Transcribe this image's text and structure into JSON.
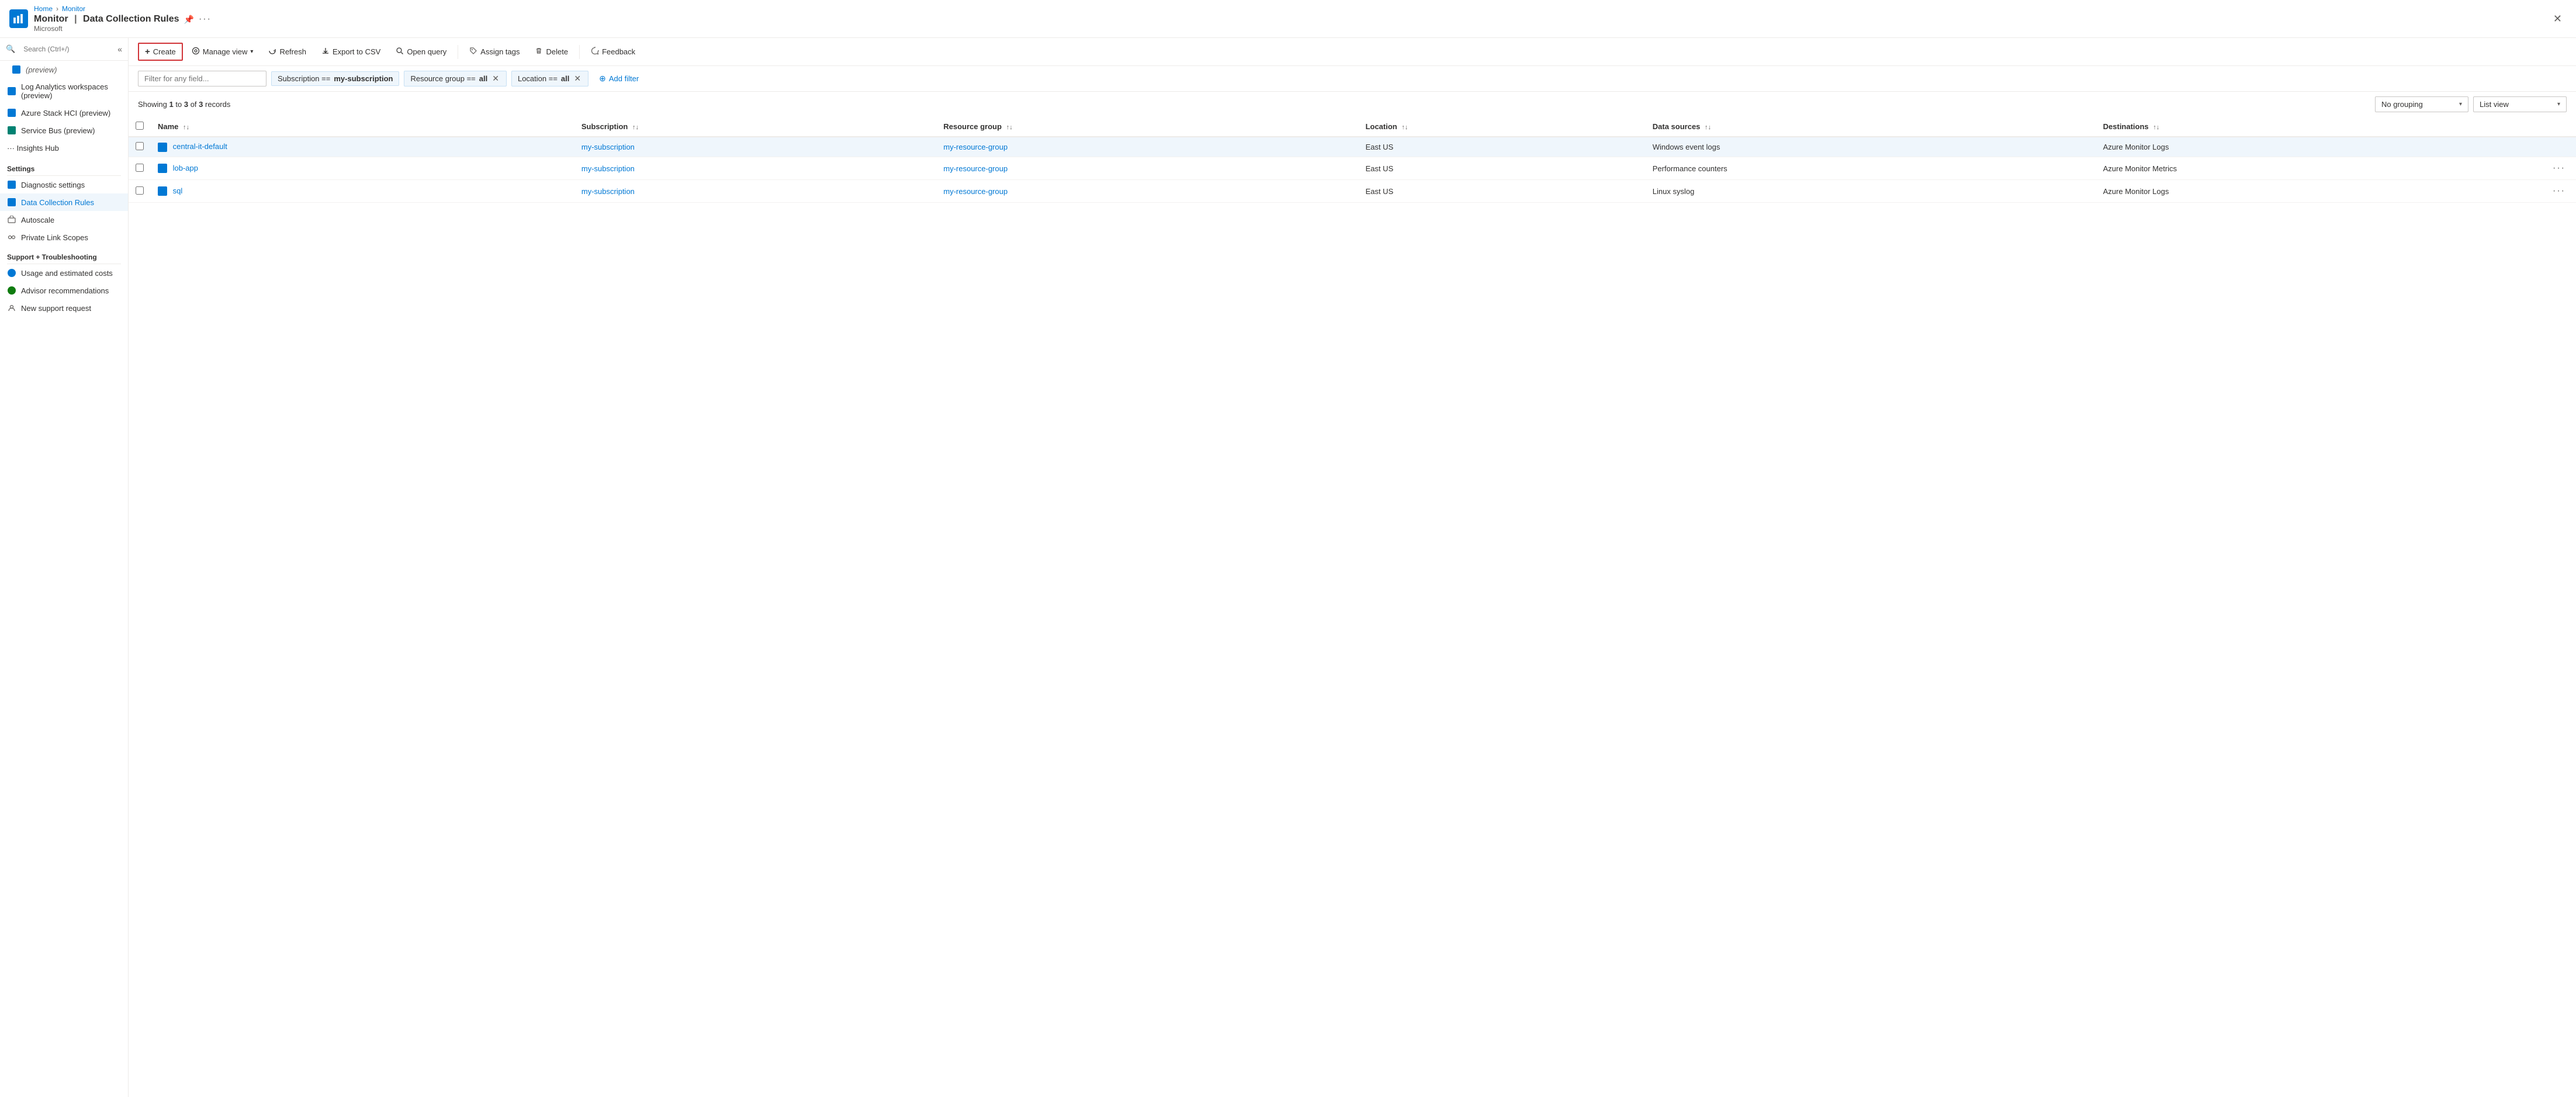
{
  "app": {
    "breadcrumb": [
      "Home",
      "Monitor"
    ],
    "icon": "📊",
    "title": "Monitor",
    "subtitle": "Microsoft",
    "section_title": "Data Collection Rules",
    "pin_icon": "📌",
    "close_icon": "✕"
  },
  "sidebar": {
    "search_placeholder": "Search (Ctrl+/)",
    "collapse_icon": "«",
    "items": [
      {
        "id": "preview1",
        "label": "(preview)",
        "icon": "sq-blue",
        "indent": true
      },
      {
        "id": "log-analytics",
        "label": "Log Analytics workspaces (preview)",
        "icon": "sq-blue"
      },
      {
        "id": "azure-stack",
        "label": "Azure Stack HCI (preview)",
        "icon": "sq-blue"
      },
      {
        "id": "service-bus",
        "label": "Service Bus (preview)",
        "icon": "sq-teal"
      },
      {
        "id": "insights-hub",
        "label": "Insights Hub",
        "icon": "dots"
      }
    ],
    "settings_title": "Settings",
    "settings_items": [
      {
        "id": "diagnostic-settings",
        "label": "Diagnostic settings",
        "icon": "sq-blue"
      },
      {
        "id": "data-collection-rules",
        "label": "Data Collection Rules",
        "icon": "sq-blue",
        "active": true
      },
      {
        "id": "autoscale",
        "label": "Autoscale",
        "icon": "edit-icon"
      },
      {
        "id": "private-link-scopes",
        "label": "Private Link Scopes",
        "icon": "link-icon"
      }
    ],
    "support_title": "Support + Troubleshooting",
    "support_items": [
      {
        "id": "usage-costs",
        "label": "Usage and estimated costs",
        "icon": "circle-blue"
      },
      {
        "id": "advisor",
        "label": "Advisor recommendations",
        "icon": "circle-green"
      },
      {
        "id": "new-support",
        "label": "New support request",
        "icon": "person-icon"
      }
    ]
  },
  "toolbar": {
    "create_label": "Create",
    "manage_view_label": "Manage view",
    "refresh_label": "Refresh",
    "export_label": "Export to CSV",
    "open_query_label": "Open query",
    "assign_tags_label": "Assign tags",
    "delete_label": "Delete",
    "feedback_label": "Feedback"
  },
  "filter_bar": {
    "filter_placeholder": "Filter for any field...",
    "subscription_filter": {
      "label": "Subscription ==",
      "value": "my-subscription"
    },
    "resource_group_filter": {
      "label": "Resource group ==",
      "value": "all"
    },
    "location_filter": {
      "label": "Location ==",
      "value": "all"
    },
    "add_filter_label": "Add filter"
  },
  "records_bar": {
    "showing_text": "Showing",
    "from": "1",
    "to": "3",
    "of": "3",
    "records_label": "records",
    "no_grouping_label": "No grouping",
    "list_view_label": "List view"
  },
  "table": {
    "headers": [
      {
        "id": "name",
        "label": "Name",
        "sortable": true
      },
      {
        "id": "subscription",
        "label": "Subscription",
        "sortable": true
      },
      {
        "id": "resource-group",
        "label": "Resource group",
        "sortable": true
      },
      {
        "id": "location",
        "label": "Location",
        "sortable": true
      },
      {
        "id": "data-sources",
        "label": "Data sources",
        "sortable": true
      },
      {
        "id": "destinations",
        "label": "Destinations",
        "sortable": true
      }
    ],
    "rows": [
      {
        "id": "row1",
        "name": "central-it-default",
        "subscription": "my-subscription",
        "resource_group": "my-resource-group",
        "location": "East US",
        "data_sources": "Windows event logs",
        "destinations": "Azure Monitor Logs",
        "has_more": false,
        "highlighted": true
      },
      {
        "id": "row2",
        "name": "lob-app",
        "subscription": "my-subscription",
        "resource_group": "my-resource-group",
        "location": "East US",
        "data_sources": "Performance counters",
        "destinations": "Azure Monitor Metrics",
        "has_more": true,
        "highlighted": false
      },
      {
        "id": "row3",
        "name": "sql",
        "subscription": "my-subscription",
        "resource_group": "my-resource-group",
        "location": "East US",
        "data_sources": "Linux syslog",
        "destinations": "Azure Monitor Logs",
        "has_more": true,
        "highlighted": false
      }
    ]
  }
}
